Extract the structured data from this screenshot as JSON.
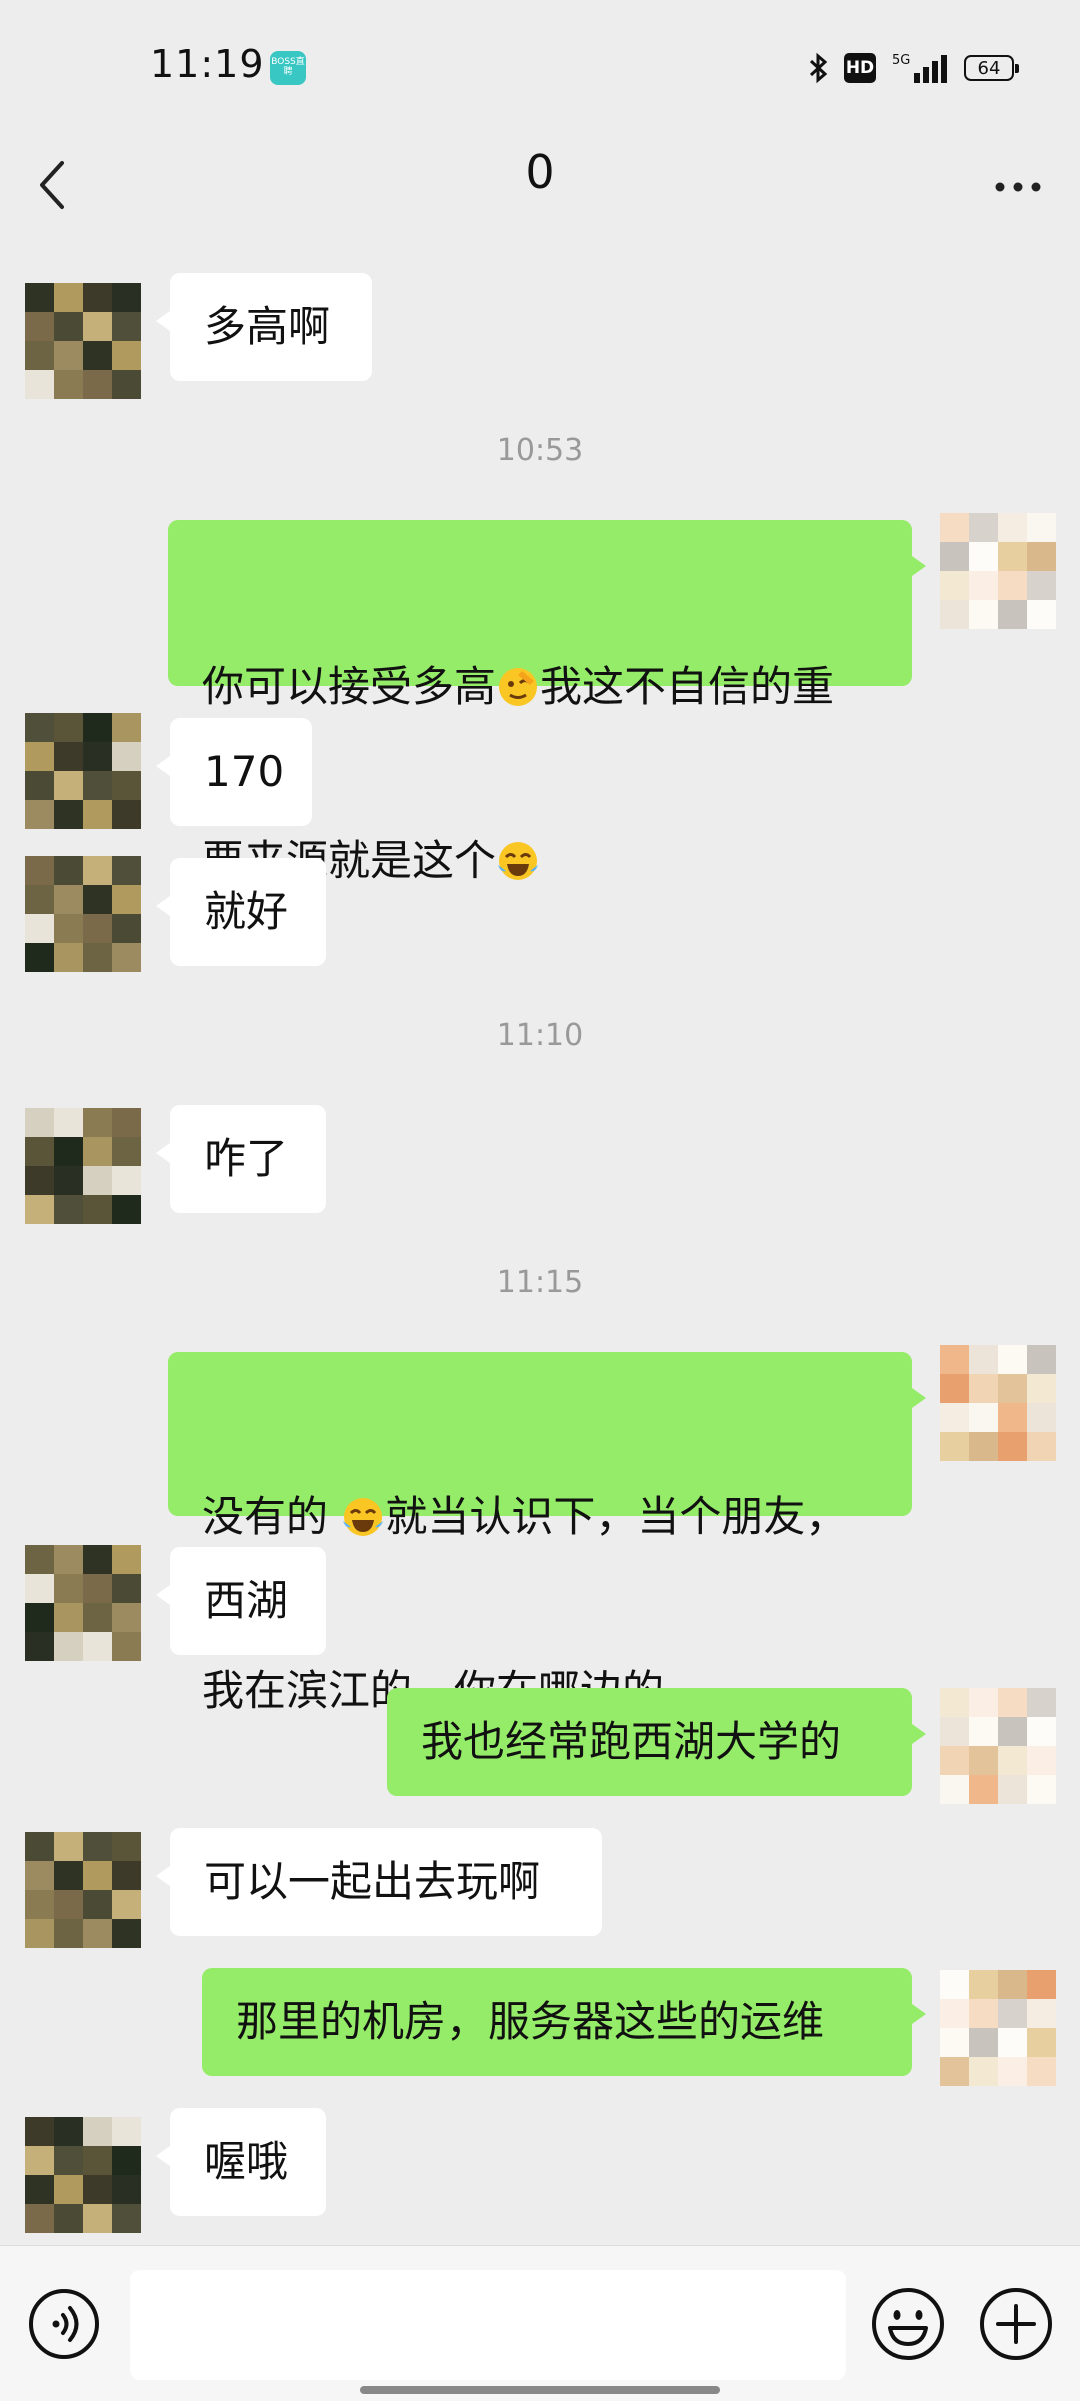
{
  "status_bar": {
    "time": "11:19",
    "app_badge": "BOSS直聘",
    "network": "5G",
    "battery": "64"
  },
  "nav": {
    "title": "0"
  },
  "messages": [
    {
      "text": "多高啊"
    },
    {
      "text": "你可以接受多高",
      "text2": "我这不自信的重",
      "line2": "要来源就是这个"
    },
    {
      "text": "170"
    },
    {
      "text": "就好"
    },
    {
      "text": "咋了"
    },
    {
      "text": "没有的 ",
      "text2": "就当认识下，当个朋友，",
      "line2": "我在滨江的，你在哪边的"
    },
    {
      "text": "西湖"
    },
    {
      "text": "我也经常跑西湖大学的"
    },
    {
      "text": "可以一起出去玩啊"
    },
    {
      "text": "那里的机房，服务器这些的运维"
    },
    {
      "text": "喔哦"
    }
  ],
  "timestamps": [
    "10:53",
    "11:10",
    "11:15"
  ],
  "icons": {
    "back": "back-arrow-icon",
    "more": "more-dots-icon",
    "voice": "voice-icon",
    "emoji": "emoji-icon",
    "plus": "plus-icon",
    "bluetooth": "bluetooth-icon",
    "signal": "signal-icon"
  },
  "colors": {
    "background": "#ededed",
    "outgoing_bubble": "#95ec69",
    "incoming_bubble": "#ffffff",
    "timestamp": "#999999"
  }
}
